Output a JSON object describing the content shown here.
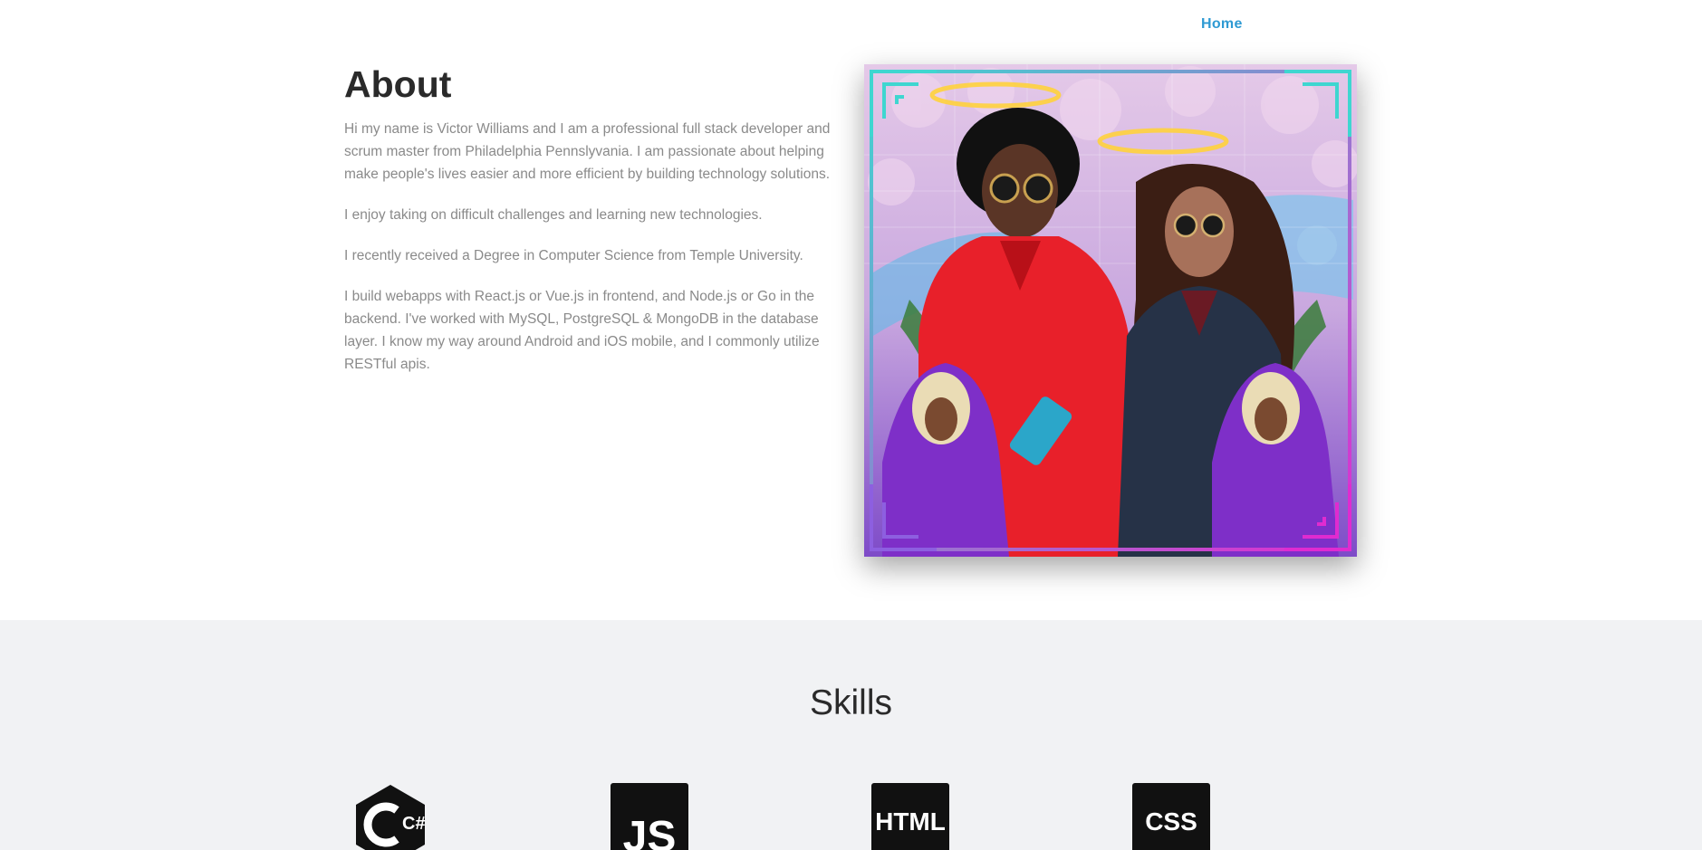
{
  "nav": {
    "items": [
      {
        "label": "Home"
      }
    ]
  },
  "about": {
    "title": "About",
    "paragraphs": [
      "Hi my name is Victor Williams and I am a professional full stack developer and scrum master from Philadelphia Pennslyvania. I am passionate about helping make people's lives easier and more efficient by building technology solutions.",
      "I enjoy taking on difficult challenges and learning new technologies.",
      "I recently received a Degree in Computer Science from Temple University.",
      "I build webapps with React.js or Vue.js in frontend, and Node.js or Go in the backend. I've worked with MySQL, PostgreSQL & MongoDB in the database layer. I know my way around Android and iOS mobile, and I commonly utilize RESTful apis."
    ],
    "photo": {
      "description_icon": "profile-collage-image",
      "accent_colors": [
        "#3fd6d0",
        "#e02bd0",
        "#e8202a"
      ]
    }
  },
  "skills": {
    "title": "Skills",
    "items": [
      {
        "label": "C#",
        "icon": "csharp-icon"
      },
      {
        "label": "JS",
        "icon": "javascript-icon"
      },
      {
        "label": "HTML",
        "icon": "html-icon"
      },
      {
        "label": "CSS",
        "icon": "css-icon"
      }
    ]
  }
}
